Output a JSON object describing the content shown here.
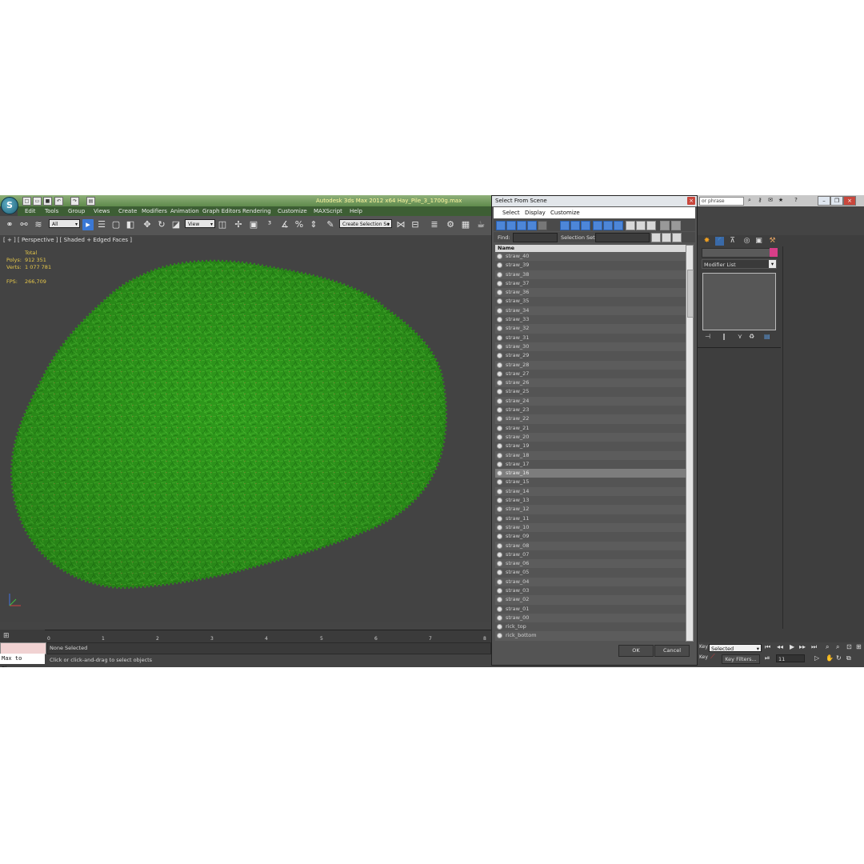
{
  "window": {
    "title": "Autodesk 3ds Max  2012 x64     Hay_Pile_3_1700g.max",
    "search_placeholder": "or phrase",
    "help_label": "?"
  },
  "menu": [
    "Edit",
    "Tools",
    "Group",
    "Views",
    "Create",
    "Modifiers",
    "Animation",
    "Graph Editors",
    "Rendering",
    "Customize",
    "MAXScript",
    "Help"
  ],
  "toolbar": {
    "filter_value": "All",
    "refcoord_value": "View",
    "selection_set_placeholder": "Create Selection Se"
  },
  "viewport": {
    "label": "[ + ] [ Perspective ] [ Shaded + Edged Faces ]",
    "stats_header": "Total",
    "polys_label": "Polys:",
    "polys_value": "912 351",
    "verts_label": "Verts:",
    "verts_value": "1 077 781",
    "fps_label": "FPS:",
    "fps_value": "266,709"
  },
  "timeline": {
    "ticks": [
      "0",
      "1",
      "2",
      "3",
      "4",
      "5",
      "6",
      "7",
      "8"
    ]
  },
  "status": {
    "maxscript_listener": "Max to Physc.",
    "selection_status": "None Selected",
    "prompt": "Click or click-and-drag to select objects"
  },
  "dialog": {
    "title": "Select From Scene",
    "menu": [
      "Select",
      "Display",
      "Customize"
    ],
    "find_label": "Find:",
    "selection_set_label": "Selection Set:",
    "column_name": "Name",
    "items": [
      "straw_40",
      "straw_39",
      "straw_38",
      "straw_37",
      "straw_36",
      "straw_35",
      "straw_34",
      "straw_33",
      "straw_32",
      "straw_31",
      "straw_30",
      "straw_29",
      "straw_28",
      "straw_27",
      "straw_26",
      "straw_25",
      "straw_24",
      "straw_23",
      "straw_22",
      "straw_21",
      "straw_20",
      "straw_19",
      "straw_18",
      "straw_17",
      "straw_16",
      "straw_15",
      "straw_14",
      "straw_13",
      "straw_12",
      "straw_11",
      "straw_10",
      "straw_09",
      "straw_08",
      "straw_07",
      "straw_06",
      "straw_05",
      "straw_04",
      "straw_03",
      "straw_02",
      "straw_01",
      "straw_00",
      "rick_top",
      "rick_bottom"
    ],
    "selected_item": "straw_16",
    "ok_label": "OK",
    "cancel_label": "Cancel"
  },
  "command_panel": {
    "modifier_list_label": "Modifier List",
    "object_color": "#d83e88"
  },
  "animation_controls": {
    "key_label": "Key",
    "set_key_mode": "Selected",
    "key_filters_label": "Key Filters...",
    "current_frame": "11"
  },
  "colors": {
    "viewport_bg": "#434343",
    "object_green": "#2f9a1c",
    "title_bar": "#6e9a5a",
    "active_tool_blue": "#3a78d6",
    "stats_yellow": "#e7c84a"
  }
}
